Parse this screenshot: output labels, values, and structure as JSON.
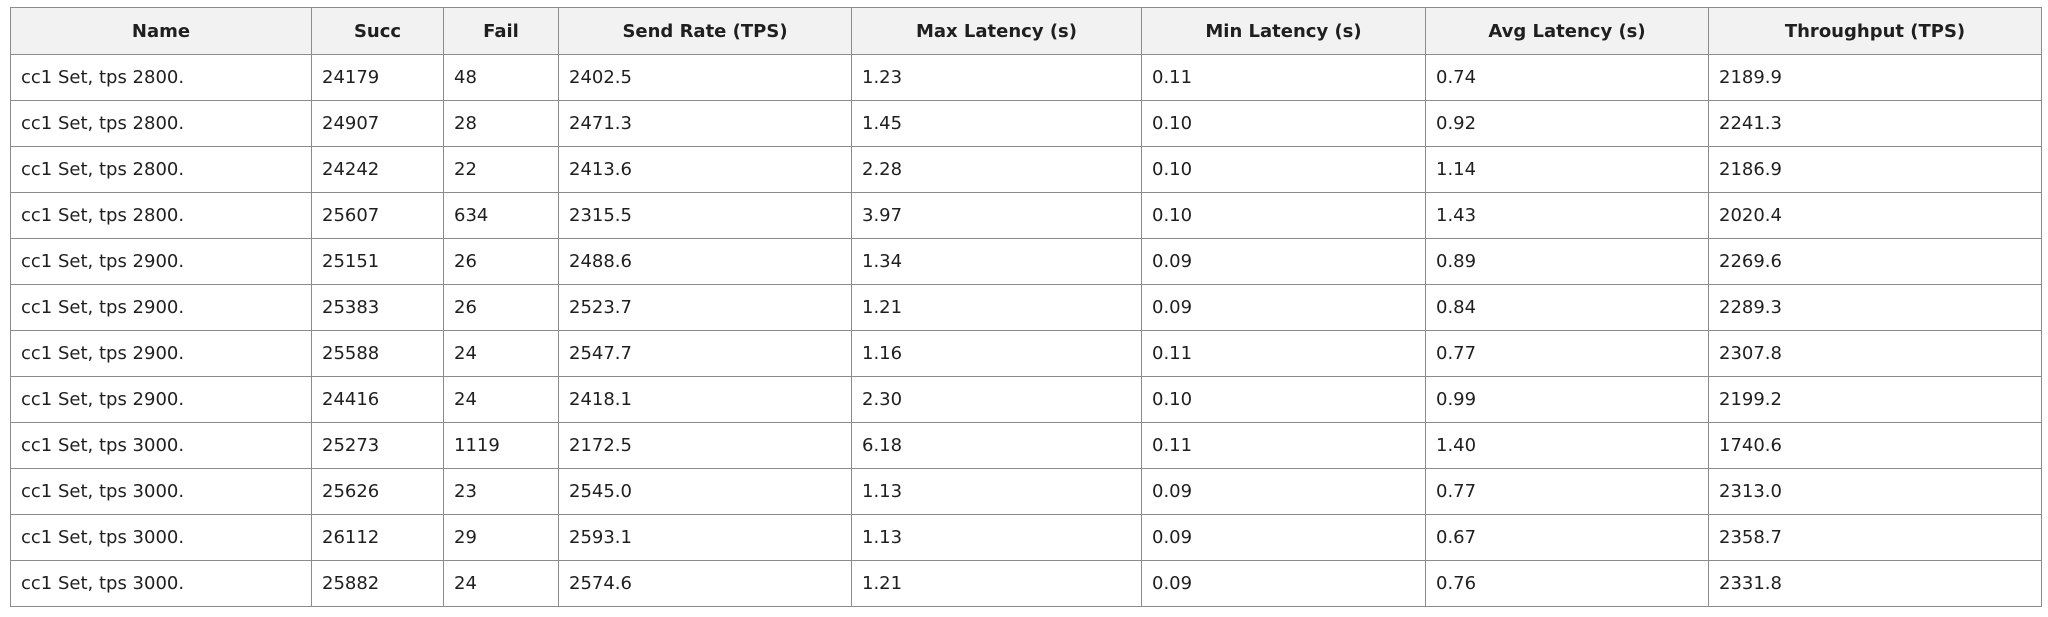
{
  "table": {
    "columns": [
      "Name",
      "Succ",
      "Fail",
      "Send Rate (TPS)",
      "Max Latency (s)",
      "Min Latency (s)",
      "Avg Latency (s)",
      "Throughput (TPS)"
    ],
    "rows": [
      [
        "cc1 Set, tps 2800.",
        "24179",
        "48",
        "2402.5",
        "1.23",
        "0.11",
        "0.74",
        "2189.9"
      ],
      [
        "cc1 Set, tps 2800.",
        "24907",
        "28",
        "2471.3",
        "1.45",
        "0.10",
        "0.92",
        "2241.3"
      ],
      [
        "cc1 Set, tps 2800.",
        "24242",
        "22",
        "2413.6",
        "2.28",
        "0.10",
        "1.14",
        "2186.9"
      ],
      [
        "cc1 Set, tps 2800.",
        "25607",
        "634",
        "2315.5",
        "3.97",
        "0.10",
        "1.43",
        "2020.4"
      ],
      [
        "cc1 Set, tps 2900.",
        "25151",
        "26",
        "2488.6",
        "1.34",
        "0.09",
        "0.89",
        "2269.6"
      ],
      [
        "cc1 Set, tps 2900.",
        "25383",
        "26",
        "2523.7",
        "1.21",
        "0.09",
        "0.84",
        "2289.3"
      ],
      [
        "cc1 Set, tps 2900.",
        "25588",
        "24",
        "2547.7",
        "1.16",
        "0.11",
        "0.77",
        "2307.8"
      ],
      [
        "cc1 Set, tps 2900.",
        "24416",
        "24",
        "2418.1",
        "2.30",
        "0.10",
        "0.99",
        "2199.2"
      ],
      [
        "cc1 Set, tps 3000.",
        "25273",
        "1119",
        "2172.5",
        "6.18",
        "0.11",
        "1.40",
        "1740.6"
      ],
      [
        "cc1 Set, tps 3000.",
        "25626",
        "23",
        "2545.0",
        "1.13",
        "0.09",
        "0.77",
        "2313.0"
      ],
      [
        "cc1 Set, tps 3000.",
        "26112",
        "29",
        "2593.1",
        "1.13",
        "0.09",
        "0.67",
        "2358.7"
      ],
      [
        "cc1 Set, tps 3000.",
        "25882",
        "24",
        "2574.6",
        "1.21",
        "0.09",
        "0.76",
        "2331.8"
      ]
    ]
  }
}
